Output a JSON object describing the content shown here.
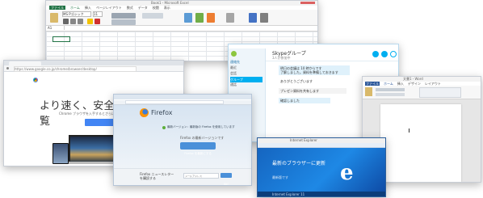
{
  "excel": {
    "title": "Book1 - Microsoft Excel",
    "tabs": [
      "ファイル",
      "ホーム",
      "挿入",
      "ページレイアウト",
      "数式",
      "データ",
      "校閲",
      "表示"
    ],
    "font": "MS Pゴシック",
    "font_size": "11",
    "cell_ref": "A1",
    "accent": "#217346"
  },
  "chrome": {
    "url": "https://www.google.co.jp/chrome/browser/desktop/",
    "heading": "より速く、安全にウェブを閲覧",
    "sub": "Chrome ブラウザを入手するとさらに便利",
    "download_label": "Chrome をダウンロード"
  },
  "firefox": {
    "brand": "Firefox",
    "notice": "最新バージョン：最新版の Firefox を使用しています",
    "message": "Firefox の最新バージョンです",
    "button_label": "Firefox を最新にする",
    "footer_heading": "Firefox ニュースレター",
    "footer_sub": "を購読する",
    "footer_input_placeholder": "メールアドレス",
    "footer_button_label": "購読",
    "accent": "#0a84ff"
  },
  "skype": {
    "title": "Skypeグループ",
    "subtitle": "3人が参加中",
    "sidebar_items": [
      "連絡先",
      "最近",
      "会話",
      "グループ",
      "通話"
    ],
    "messages": [
      "明日の会議は 10 時からです",
      "了解しました。資料を準備しておきます",
      "ありがとうございます",
      "プレゼン資料を共有します",
      "確認しました"
    ],
    "accent": "#00aff0"
  },
  "word": {
    "title": "文書1 - Word",
    "tabs": [
      "ファイル",
      "ホーム",
      "挿入",
      "デザイン",
      "レイアウト"
    ]
  },
  "ie": {
    "title": "Internet Explorer",
    "heading": "最新のブラウザーに更新",
    "subheading": "最新版です",
    "footer": "Internet Explorer 11",
    "accent": "#1e78d4"
  }
}
